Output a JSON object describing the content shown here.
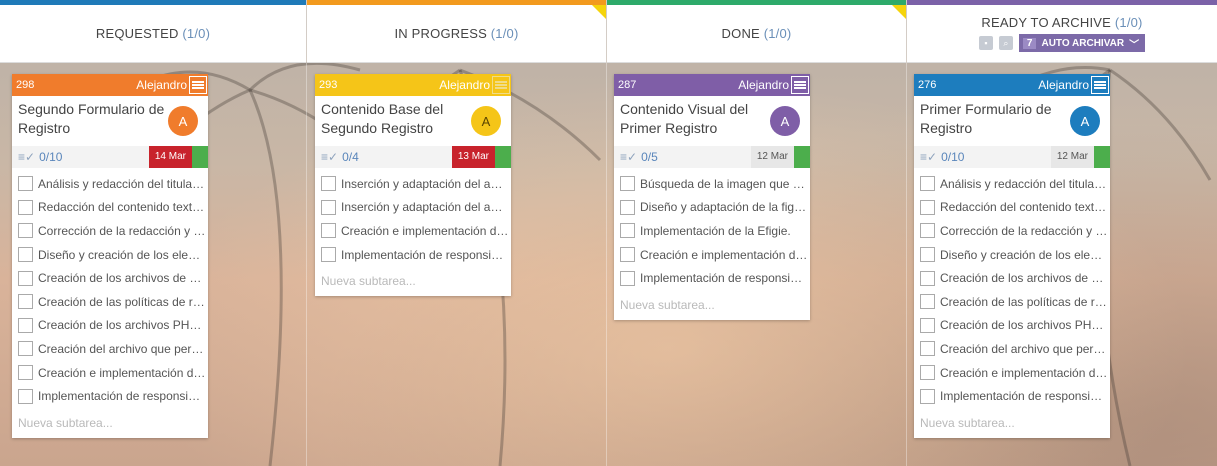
{
  "columns": [
    {
      "title": "REQUESTED",
      "count": "(1/0)",
      "color": "#1f7ab8"
    },
    {
      "title": "IN PROGRESS",
      "count": "(1/0)",
      "color": "#f29a1e"
    },
    {
      "title": "DONE",
      "count": "(1/0)",
      "color": "#2eaa6a"
    },
    {
      "title": "READY TO ARCHIVE",
      "count": "(1/0)",
      "color": "#7b62a8"
    }
  ],
  "archive": {
    "count": "7",
    "label": "AUTO ARCHIVAR"
  },
  "cards": [
    {
      "id": "298",
      "user": "Alejandro",
      "title": "Segundo Formulario de Registro",
      "avatar": "A",
      "progress": "0/10",
      "date": "14 Mar",
      "date_status": "overdue",
      "top_color": "#f07c2c",
      "avatar_color": "#f07c2c",
      "subtasks": [
        "Análisis y redacción del titular …",
        "Redacción del contenido textu…",
        "Corrección de la redacción y or…",
        "Diseño y creación de los eleme…",
        "Creación de los archivos de Jav…",
        "Creación de las políticas de res…",
        "Creación de los archivos PHP q…",
        "Creación del archivo que permi…",
        "Creación e implementación de …",
        "Implementación de responsivi…"
      ],
      "new_subtask": "Nueva subtarea..."
    },
    {
      "id": "293",
      "user": "Alejandro",
      "title": "Contenido Base del Segundo Registro",
      "avatar": "A",
      "progress": "0/4",
      "date": "13 Mar",
      "date_status": "overdue",
      "top_color": "#f5c518",
      "avatar_color": "#f5c518",
      "subtasks": [
        "Inserción y adaptación del apa…",
        "Inserción y adaptación del apa…",
        "Creación e implementación de …",
        "Implementación de responsivi…"
      ],
      "new_subtask": "Nueva subtarea..."
    },
    {
      "id": "287",
      "user": "Alejandro",
      "title": "Contenido Visual del Primer Registro",
      "avatar": "A",
      "progress": "0/5",
      "date": "12 Mar",
      "date_status": "normal",
      "top_color": "#7f5ea7",
      "avatar_color": "#7f5ea7",
      "subtasks": [
        "Búsqueda de la imagen que se …",
        "Diseño y adaptación de la figur…",
        "Implementación de la Efigie.",
        "Creación e implementación de …",
        "Implementación de responsivi…"
      ],
      "new_subtask": "Nueva subtarea..."
    },
    {
      "id": "276",
      "user": "Alejandro",
      "title": "Primer Formulario de Registro",
      "avatar": "A",
      "progress": "0/10",
      "date": "12 Mar",
      "date_status": "normal",
      "top_color": "#1d7dbe",
      "avatar_color": "#1d7dbe",
      "subtasks": [
        "Análisis y redacción del titular …",
        "Redacción del contenido textu…",
        "Corrección de la redacción y or…",
        "Diseño y creación de los eleme…",
        "Creación de los archivos de Jav…",
        "Creación de las políticas de res…",
        "Creación de los archivos PHP q…",
        "Creación del archivo que permi…",
        "Creación e implementación de …",
        "Implementación de responsivi…"
      ],
      "new_subtask": "Nueva subtarea..."
    }
  ]
}
